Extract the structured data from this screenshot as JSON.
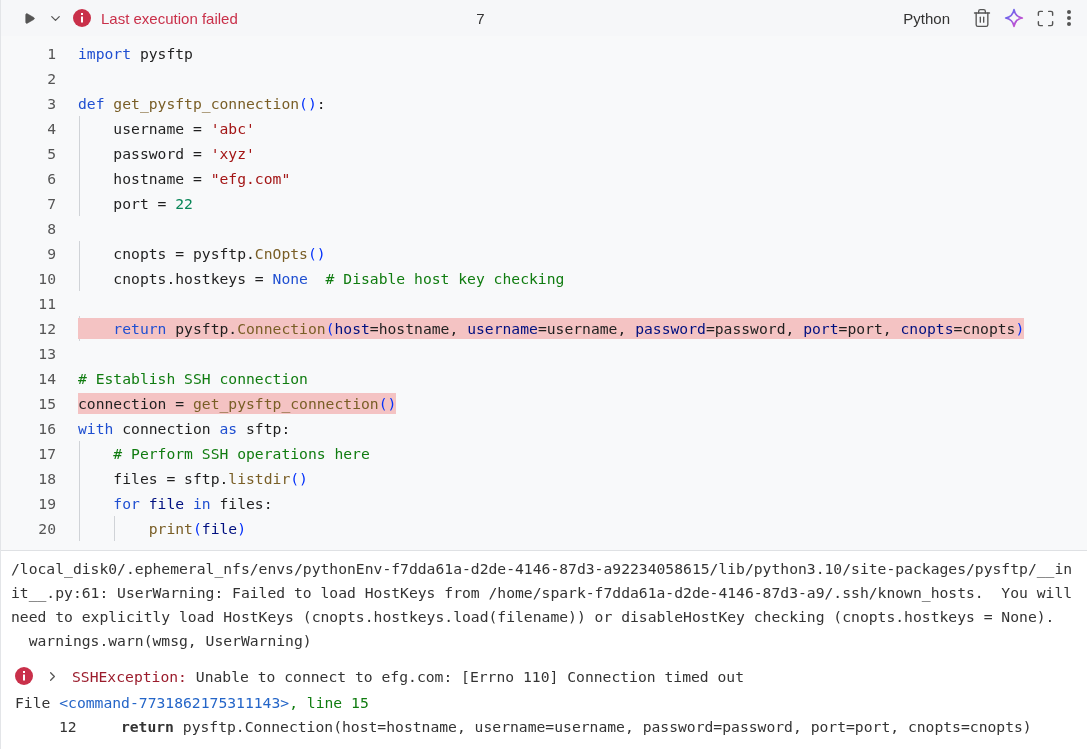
{
  "cell": {
    "status": {
      "text": "Last execution failed",
      "failed": true
    },
    "collapsed": false,
    "execution_count": "7",
    "language": "Python"
  },
  "code_lines": [
    {
      "number": "1",
      "highlighted": false,
      "tokens": [
        {
          "kind": "keyword",
          "text": "import"
        },
        {
          "kind": "plain",
          "text": " pysftp"
        }
      ]
    },
    {
      "number": "2"
    },
    {
      "number": "3",
      "highlighted": false,
      "tokens": [
        {
          "kind": "keyword",
          "text": "def"
        },
        {
          "kind": "function",
          "text": " get_pysftp_connection"
        },
        {
          "kind": "paren",
          "text": "()"
        },
        {
          "kind": "plain",
          "text": ":"
        }
      ]
    },
    {
      "number": "4",
      "highlighted": false,
      "tokens": [
        {
          "kind": "plain",
          "text": "    username = "
        },
        {
          "kind": "string",
          "text": "'abc'"
        }
      ]
    },
    {
      "number": "5",
      "highlighted": false,
      "tokens": [
        {
          "kind": "plain",
          "text": "    password = "
        },
        {
          "kind": "string",
          "text": "'xyz'"
        }
      ]
    },
    {
      "number": "6",
      "highlighted": false,
      "tokens": [
        {
          "kind": "plain",
          "text": "    hostname = "
        },
        {
          "kind": "string",
          "text": "\"efg.com\""
        }
      ]
    },
    {
      "number": "7",
      "highlighted": false,
      "tokens": [
        {
          "kind": "plain",
          "text": "    port = "
        },
        {
          "kind": "number",
          "text": "22"
        }
      ]
    },
    {
      "number": "8"
    },
    {
      "number": "9",
      "highlighted": false,
      "tokens": [
        {
          "kind": "plain",
          "text": "    cnopts = pysftp."
        },
        {
          "kind": "function",
          "text": "CnOpts"
        },
        {
          "kind": "paren",
          "text": "()"
        }
      ]
    },
    {
      "number": "10",
      "highlighted": false,
      "tokens": [
        {
          "kind": "plain",
          "text": "    cnopts.hostkeys = "
        },
        {
          "kind": "keyword",
          "text": "None"
        },
        {
          "kind": "comment",
          "text": "  # Disable host key checking"
        }
      ]
    },
    {
      "number": "11"
    },
    {
      "number": "12",
      "highlighted": true,
      "tokens": [
        {
          "kind": "keyword",
          "text": "    return"
        },
        {
          "kind": "plain",
          "text": " pysftp."
        },
        {
          "kind": "function",
          "text": "Connection"
        },
        {
          "kind": "paren",
          "text": "("
        },
        {
          "kind": "param",
          "text": "host"
        },
        {
          "kind": "plain",
          "text": "=hostname, "
        },
        {
          "kind": "param",
          "text": "username"
        },
        {
          "kind": "plain",
          "text": "=username, "
        },
        {
          "kind": "param",
          "text": "password"
        },
        {
          "kind": "plain",
          "text": "=password, "
        },
        {
          "kind": "param",
          "text": "port"
        },
        {
          "kind": "plain",
          "text": "=port, "
        },
        {
          "kind": "param",
          "text": "cnopts"
        },
        {
          "kind": "plain",
          "text": "=cnopts"
        },
        {
          "kind": "paren",
          "text": ")"
        }
      ]
    },
    {
      "number": "13"
    },
    {
      "number": "14",
      "highlighted": false,
      "tokens": [
        {
          "kind": "comment",
          "text": "# Establish SSH connection"
        }
      ]
    },
    {
      "number": "15",
      "highlighted": true,
      "tokens": [
        {
          "kind": "plain",
          "text": "connection = "
        },
        {
          "kind": "function",
          "text": "get_pysftp_connection"
        },
        {
          "kind": "paren",
          "text": "()"
        }
      ]
    },
    {
      "number": "16",
      "highlighted": false,
      "tokens": [
        {
          "kind": "keyword",
          "text": "with"
        },
        {
          "kind": "plain",
          "text": " connection "
        },
        {
          "kind": "keyword",
          "text": "as"
        },
        {
          "kind": "plain",
          "text": " sftp:"
        }
      ]
    },
    {
      "number": "17",
      "highlighted": false,
      "tokens": [
        {
          "kind": "comment",
          "text": "    # Perform SSH operations here"
        }
      ]
    },
    {
      "number": "18",
      "highlighted": false,
      "tokens": [
        {
          "kind": "plain",
          "text": "    files = sftp."
        },
        {
          "kind": "function",
          "text": "listdir"
        },
        {
          "kind": "paren",
          "text": "()"
        }
      ]
    },
    {
      "number": "19",
      "highlighted": false,
      "tokens": [
        {
          "kind": "keyword",
          "text": "    for"
        },
        {
          "kind": "param",
          "text": " file"
        },
        {
          "kind": "keyword",
          "text": " in"
        },
        {
          "kind": "plain",
          "text": " files:"
        }
      ]
    },
    {
      "number": "20",
      "highlighted": false,
      "tokens": [
        {
          "kind": "function",
          "text": "        print"
        },
        {
          "kind": "paren",
          "text": "("
        },
        {
          "kind": "param",
          "text": "file"
        },
        {
          "kind": "paren",
          "text": ")"
        }
      ]
    }
  ],
  "output": {
    "warning_lines": [
      "/local_disk0/.ephemeral_nfs/envs/pythonEnv-f7dda61a-d2de-4146-87d3-a92234058615/lib/python3.10/site-packages/pysftp/__in",
      "it__.py:61: UserWarning: Failed to load HostKeys from /home/spark-f7dda61a-d2de-4146-87d3-a9/.ssh/known_hosts.  You will",
      "need to explicitly load HostKeys (cnopts.hostkeys.load(filename)) or disableHostKey checking (cnopts.hostkeys = None).",
      "  warnings.warn(wmsg, UserWarning)"
    ],
    "error": {
      "name": "SSHException:",
      "message": " Unable to connect to efg.com: [Errno 110] Connection timed out",
      "expanded": false
    },
    "traceback": {
      "file_label": "File ",
      "command": "<command-7731862175311143>",
      "line_ref": ", line 15",
      "frame_line": "12     **return** pysftp.Connection(host=hostname, username=username, password=password, port=port, cnopts=cnopts)"
    }
  }
}
